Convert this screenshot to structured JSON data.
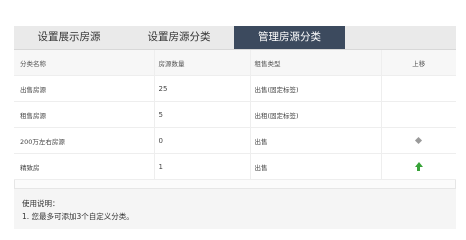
{
  "tabs": [
    {
      "label": "设置展示房源",
      "active": false
    },
    {
      "label": "设置房源分类",
      "active": false
    },
    {
      "label": "管理房源分类",
      "active": true
    }
  ],
  "table": {
    "headers": [
      "分类名称",
      "房源数量",
      "租售类型",
      "上移"
    ],
    "rows": [
      {
        "name": "出售房源",
        "count": "25",
        "type": "出售(固定标签)",
        "move": "none"
      },
      {
        "name": "租售房源",
        "count": "5",
        "type": "出租(固定标签)",
        "move": "none"
      },
      {
        "name": "200万左右房源",
        "count": "0",
        "type": "出售",
        "move": "diamond-icon"
      },
      {
        "name": "精致房",
        "count": "1",
        "type": "出售",
        "move": "arrow-up-icon"
      }
    ]
  },
  "notes": {
    "title": "使用说明：",
    "items": [
      "1. 您最多可添加3个自定义分类。"
    ]
  },
  "colors": {
    "active_tab": "#3c4a5e",
    "arrow_up": "#37a338",
    "diamond": "#9a9a9a"
  }
}
